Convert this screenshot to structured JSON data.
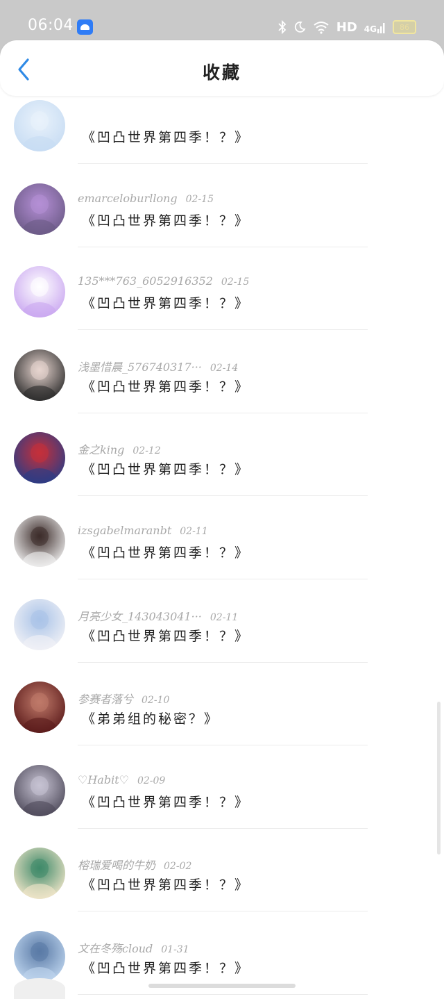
{
  "status_bar": {
    "time": "06:04",
    "hd": "HD",
    "network": "4G",
    "battery": "86",
    "icons": [
      "app-notification-icon",
      "bluetooth-icon",
      "moon-icon",
      "wifi-icon",
      "signal-icon",
      "battery-icon"
    ]
  },
  "header": {
    "title": "收藏",
    "back_icon": "chevron-left-icon",
    "accent_color": "#2f8ae6"
  },
  "items": [
    {
      "user": "",
      "date": "",
      "title": "《凹凸世界第四季！？》",
      "avatar_colors": [
        "#c7dcf3",
        "#e9f2fb"
      ]
    },
    {
      "user": "emarceloburllong",
      "date": "02-15",
      "title": "《凹凸世界第四季！？》",
      "avatar_colors": [
        "#6b5a86",
        "#b58fd6"
      ]
    },
    {
      "user": "135***763_6052916352",
      "date": "02-15",
      "title": "《凹凸世界第四季！？》",
      "avatar_colors": [
        "#c9a6f0",
        "#ffffff"
      ]
    },
    {
      "user": "浅墨惜晨_576740317···",
      "date": "02-14",
      "title": "《凹凸世界第四季！？》",
      "avatar_colors": [
        "#2a2a2a",
        "#e8d6d0"
      ]
    },
    {
      "user": "金之king",
      "date": "02-12",
      "title": "《凹凸世界第四季！？》",
      "avatar_colors": [
        "#2a3c86",
        "#c5303a"
      ]
    },
    {
      "user": "izsgabelmaranbt",
      "date": "02-11",
      "title": "《凹凸世界第四季！？》",
      "avatar_colors": [
        "#f1f1f1",
        "#3c2c2a"
      ]
    },
    {
      "user": "月亮少女_143043041···",
      "date": "02-11",
      "title": "《凹凸世界第四季！？》",
      "avatar_colors": [
        "#f2f2f6",
        "#a9c3e8"
      ]
    },
    {
      "user": "参赛者落兮",
      "date": "02-10",
      "title": "《弟弟组的秘密？》",
      "avatar_colors": [
        "#5a1a1a",
        "#c07a6a"
      ]
    },
    {
      "user": "♡Habit♡",
      "date": "02-09",
      "title": "《凹凸世界第四季！？》",
      "avatar_colors": [
        "#4e4a5a",
        "#c7c3d3"
      ]
    },
    {
      "user": "榕瑞爱喝的牛奶",
      "date": "02-02",
      "title": "《凹凸世界第四季！？》",
      "avatar_colors": [
        "#f2e6c9",
        "#3f8a6a"
      ]
    },
    {
      "user": "文在冬殇cloud",
      "date": "01-31",
      "title": "《凹凸世界第四季！？》",
      "avatar_colors": [
        "#bfd6ef",
        "#5a7aa6"
      ]
    }
  ]
}
